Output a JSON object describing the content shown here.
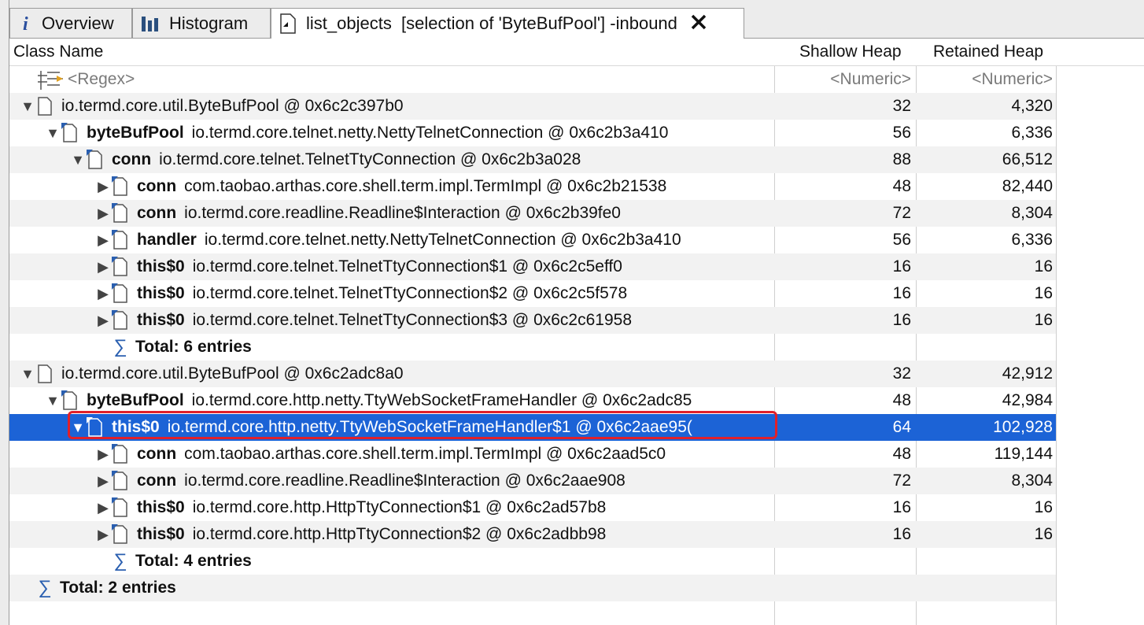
{
  "tabs": [
    {
      "label": "Overview",
      "icon": "info-icon",
      "active": false
    },
    {
      "label": "Histogram",
      "icon": "histogram-icon",
      "active": false
    },
    {
      "label": "list_objects  [selection of 'ByteBufPool'] -inbound",
      "icon": "query-result-icon",
      "active": true
    }
  ],
  "columns": {
    "class_name": "Class Name",
    "shallow_heap": "Shallow Heap",
    "retained_heap": "Retained Heap"
  },
  "filter_row": {
    "name": "<Regex>",
    "shallow": "<Numeric>",
    "retained": "<Numeric>"
  },
  "rows": [
    {
      "level": 0,
      "toggle": "expanded",
      "field": "",
      "cls": "io.termd.core.util.ByteBufPool @ 0x6c2c397b0",
      "shallow": "32",
      "retained": "4,320"
    },
    {
      "level": 1,
      "toggle": "expanded",
      "field": "byteBufPool",
      "cls": "io.termd.core.telnet.netty.NettyTelnetConnection @ 0x6c2b3a410",
      "shallow": "56",
      "retained": "6,336"
    },
    {
      "level": 2,
      "toggle": "expanded",
      "field": "conn",
      "cls": "io.termd.core.telnet.TelnetTtyConnection @ 0x6c2b3a028",
      "shallow": "88",
      "retained": "66,512"
    },
    {
      "level": 3,
      "toggle": "collapsed",
      "field": "conn",
      "cls": "com.taobao.arthas.core.shell.term.impl.TermImpl @ 0x6c2b21538",
      "shallow": "48",
      "retained": "82,440"
    },
    {
      "level": 3,
      "toggle": "collapsed",
      "field": "conn",
      "cls": "io.termd.core.readline.Readline$Interaction @ 0x6c2b39fe0",
      "shallow": "72",
      "retained": "8,304"
    },
    {
      "level": 3,
      "toggle": "collapsed",
      "field": "handler",
      "cls": "io.termd.core.telnet.netty.NettyTelnetConnection @ 0x6c2b3a410",
      "shallow": "56",
      "retained": "6,336"
    },
    {
      "level": 3,
      "toggle": "collapsed",
      "field": "this$0",
      "cls": "io.termd.core.telnet.TelnetTtyConnection$1 @ 0x6c2c5eff0",
      "shallow": "16",
      "retained": "16"
    },
    {
      "level": 3,
      "toggle": "collapsed",
      "field": "this$0",
      "cls": "io.termd.core.telnet.TelnetTtyConnection$2 @ 0x6c2c5f578",
      "shallow": "16",
      "retained": "16"
    },
    {
      "level": 3,
      "toggle": "collapsed",
      "field": "this$0",
      "cls": "io.termd.core.telnet.TelnetTtyConnection$3 @ 0x6c2c61958",
      "shallow": "16",
      "retained": "16"
    },
    {
      "level": 3,
      "total": true,
      "text": "Total: 6 entries"
    },
    {
      "level": 0,
      "toggle": "expanded",
      "field": "",
      "cls": "io.termd.core.util.ByteBufPool @ 0x6c2adc8a0",
      "shallow": "32",
      "retained": "42,912"
    },
    {
      "level": 1,
      "toggle": "expanded",
      "field": "byteBufPool",
      "cls": "io.termd.core.http.netty.TtyWebSocketFrameHandler @ 0x6c2adc85",
      "shallow": "48",
      "retained": "42,984"
    },
    {
      "level": 2,
      "toggle": "expanded",
      "field": "this$0",
      "cls": "io.termd.core.http.netty.TtyWebSocketFrameHandler$1 @ 0x6c2aae95(",
      "shallow": "64",
      "retained": "102,928",
      "selected": true
    },
    {
      "level": 3,
      "toggle": "collapsed",
      "field": "conn",
      "cls": "com.taobao.arthas.core.shell.term.impl.TermImpl @ 0x6c2aad5c0",
      "shallow": "48",
      "retained": "119,144"
    },
    {
      "level": 3,
      "toggle": "collapsed",
      "field": "conn",
      "cls": "io.termd.core.readline.Readline$Interaction @ 0x6c2aae908",
      "shallow": "72",
      "retained": "8,304"
    },
    {
      "level": 3,
      "toggle": "collapsed",
      "field": "this$0",
      "cls": "io.termd.core.http.HttpTtyConnection$1 @ 0x6c2ad57b8",
      "shallow": "16",
      "retained": "16"
    },
    {
      "level": 3,
      "toggle": "collapsed",
      "field": "this$0",
      "cls": "io.termd.core.http.HttpTtyConnection$2 @ 0x6c2adbb98",
      "shallow": "16",
      "retained": "16"
    },
    {
      "level": 3,
      "total": true,
      "text": "Total: 4 entries"
    },
    {
      "level": 0,
      "total": true,
      "text": "Total: 2 entries"
    }
  ],
  "colors": {
    "selection": "#1c63d6",
    "highlight_outline": "#e0202a",
    "alt_row": "#f2f2f2"
  }
}
